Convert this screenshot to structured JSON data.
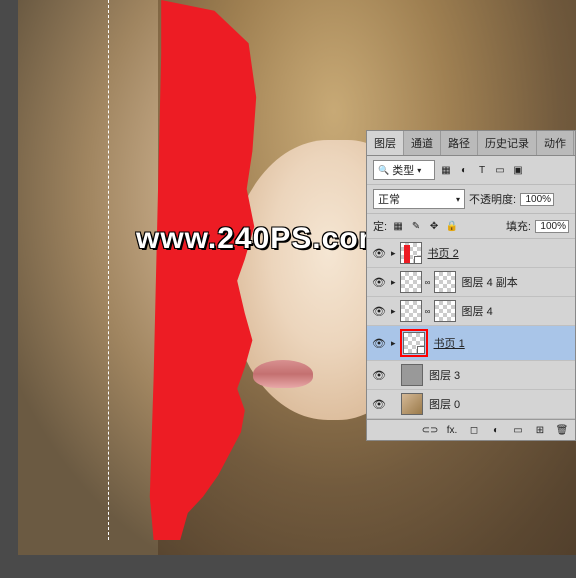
{
  "watermark": "www.240PS.com",
  "panel": {
    "tabs": [
      "图层",
      "通道",
      "路径",
      "历史记录",
      "动作"
    ],
    "activeTab": 0,
    "filterLabel": "类型",
    "blendMode": "正常",
    "opacityLabel": "不透明度:",
    "opacityValue": "100%",
    "lockLabel": "定:",
    "fillLabel": "填充:",
    "fillValue": "100%",
    "icons": {
      "image": "▦",
      "adjust": "◐",
      "text": "T",
      "shape": "▭",
      "smart": "▣"
    },
    "lockIcons": [
      "▦",
      "✎",
      "✥",
      "🔒"
    ]
  },
  "layers": [
    {
      "name": "书页 2",
      "eye": true,
      "thumbs": [
        "checker-red"
      ],
      "underline": true,
      "arrow": true
    },
    {
      "name": "图层 4 副本",
      "eye": true,
      "thumbs": [
        "checker",
        "checker"
      ],
      "arrow": true
    },
    {
      "name": "图层 4",
      "eye": true,
      "thumbs": [
        "checker",
        "checker"
      ],
      "arrow": true
    },
    {
      "name": "书页 1",
      "eye": true,
      "thumbs": [
        "checker"
      ],
      "underline": true,
      "arrow": true,
      "selected": true,
      "highlight": true
    },
    {
      "name": "图层 3",
      "eye": true,
      "thumbs": [
        "gray"
      ],
      "arrow": false
    },
    {
      "name": "图层 0",
      "eye": true,
      "thumbs": [
        "photo"
      ],
      "arrow": false
    }
  ],
  "footer": {
    "link": "⊂⊃",
    "fx": "fx.",
    "mask": "◻",
    "adjust": "◐",
    "group": "▭",
    "new": "⊞",
    "trash": "🗑"
  }
}
